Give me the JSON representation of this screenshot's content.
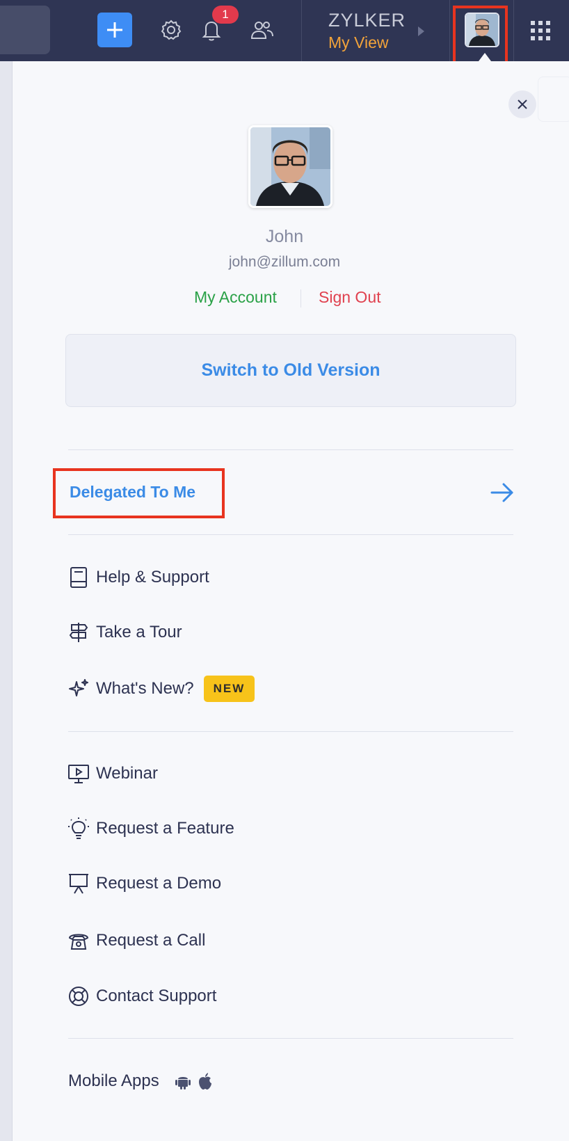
{
  "topbar": {
    "notification_count": "1",
    "org_name": "ZYLKER",
    "view_name": "My View",
    "icons": [
      "plus-icon",
      "gear-icon",
      "bell-icon",
      "users-icon",
      "app-grid-icon"
    ]
  },
  "profile": {
    "name": "John",
    "email": "john@zillum.com",
    "my_account_label": "My Account",
    "sign_out_label": "Sign Out"
  },
  "switch_label": "Switch to Old Version",
  "delegated_label": "Delegated To Me",
  "menu": {
    "group1": [
      {
        "label": "Help & Support",
        "icon": "book-icon"
      },
      {
        "label": "Take a Tour",
        "icon": "signpost-icon"
      },
      {
        "label": "What's New?",
        "icon": "sparkle-icon",
        "badge": "NEW"
      }
    ],
    "group2": [
      {
        "label": "Webinar",
        "icon": "video-presentation-icon"
      },
      {
        "label": "Request a Feature",
        "icon": "lightbulb-icon"
      },
      {
        "label": "Request a Demo",
        "icon": "presentation-board-icon"
      },
      {
        "label": "Request a Call",
        "icon": "telephone-icon"
      },
      {
        "label": "Contact Support",
        "icon": "lifebuoy-icon"
      }
    ]
  },
  "mobile_apps_label": "Mobile Apps",
  "colors": {
    "topbar_bg": "#2f3554",
    "accent_blue": "#3b8be6",
    "plus_button": "#3e8df5",
    "my_account_green": "#2aa147",
    "sign_out_red": "#e0414f",
    "new_badge_yellow": "#f7c31a",
    "view_orange": "#f2a33a",
    "highlight_red": "#e8341f"
  }
}
